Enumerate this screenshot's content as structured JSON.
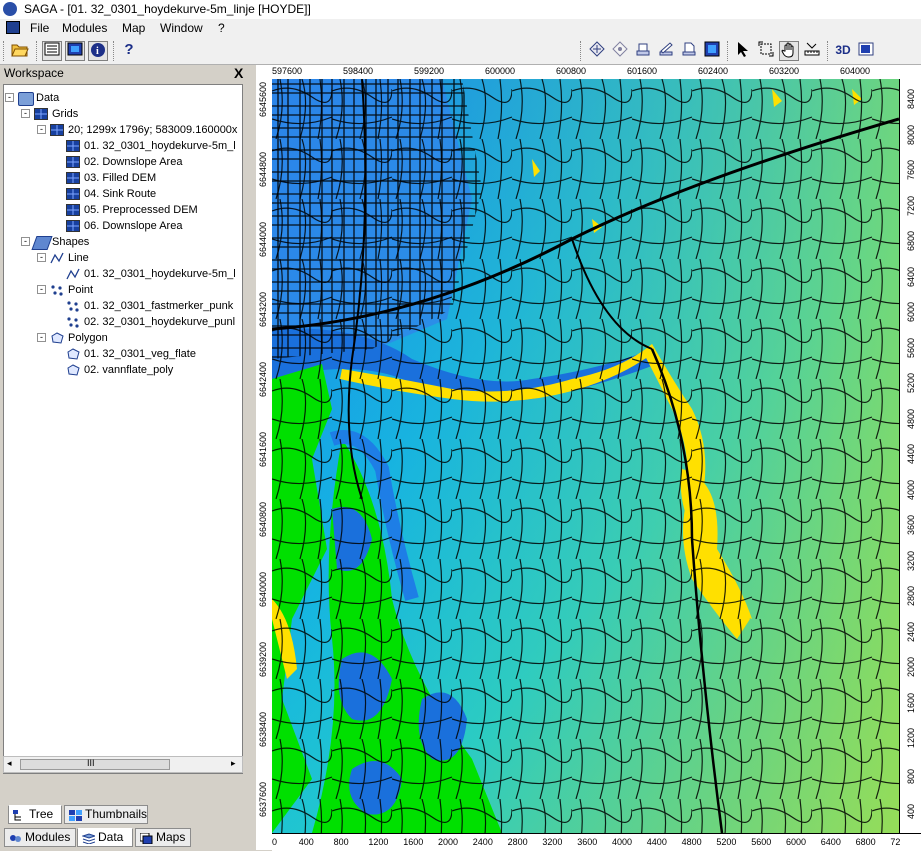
{
  "window": {
    "title": "SAGA - [01. 32_0301_hoydekurve-5m_linje [HOYDE]]"
  },
  "menu": {
    "items": [
      "File",
      "Modules",
      "Map",
      "Window",
      "?"
    ]
  },
  "toolbar": {
    "left_icons": [
      "open-icon",
      "workspace-icon",
      "object-properties-icon",
      "data-source-icon",
      "help-icon"
    ],
    "right_icons": [
      "zoom-full-icon",
      "zoom-layer-icon",
      "zoom-selection-icon",
      "zoom-active-icon",
      "synchronize-icon",
      "map-window-icon",
      "select-icon",
      "zoom-icon",
      "pan-icon",
      "measure-icon",
      "3d-view-icon",
      "layout-icon"
    ],
    "label_3d": "3D"
  },
  "workspace": {
    "title": "Workspace",
    "close_label": "X",
    "tree": [
      {
        "label": "Data",
        "level": 0,
        "icon": "data-icon",
        "expander": "-"
      },
      {
        "label": "Grids",
        "level": 1,
        "icon": "grids-icon",
        "expander": "-"
      },
      {
        "label": "20; 1299x 1796y; 583009.160000x",
        "level": 2,
        "icon": "grid-system-icon",
        "expander": "-"
      },
      {
        "label": "01. 32_0301_hoydekurve-5m_l",
        "level": 3,
        "icon": "grid-icon"
      },
      {
        "label": "02. Downslope Area",
        "level": 3,
        "icon": "grid-icon"
      },
      {
        "label": "03. Filled DEM",
        "level": 3,
        "icon": "grid-icon"
      },
      {
        "label": "04. Sink Route",
        "level": 3,
        "icon": "grid-icon"
      },
      {
        "label": "05. Preprocessed DEM",
        "level": 3,
        "icon": "grid-icon"
      },
      {
        "label": "06. Downslope Area",
        "level": 3,
        "icon": "grid-icon"
      },
      {
        "label": "Shapes",
        "level": 1,
        "icon": "shapes-icon",
        "expander": "-"
      },
      {
        "label": "Line",
        "level": 2,
        "icon": "line-icon",
        "expander": "-"
      },
      {
        "label": "01. 32_0301_hoydekurve-5m_l",
        "level": 3,
        "icon": "line-shape-icon"
      },
      {
        "label": "Point",
        "level": 2,
        "icon": "point-icon",
        "expander": "-"
      },
      {
        "label": "01. 32_0301_fastmerker_punk",
        "level": 3,
        "icon": "point-shape-icon"
      },
      {
        "label": "02. 32_0301_hoydekurve_punl",
        "level": 3,
        "icon": "point-shape-icon"
      },
      {
        "label": "Polygon",
        "level": 2,
        "icon": "polygon-icon",
        "expander": "-"
      },
      {
        "label": "01. 32_0301_veg_flate",
        "level": 3,
        "icon": "polygon-shape-icon"
      },
      {
        "label": "02. vannflate_poly",
        "level": 3,
        "icon": "polygon-shape-icon"
      }
    ],
    "scroll_grip": "III",
    "view_tabs": [
      {
        "label": "Tree",
        "active": true
      },
      {
        "label": "Thumbnails",
        "active": false
      }
    ],
    "bottom_tabs": [
      {
        "label": "Modules",
        "active": false
      },
      {
        "label": "Data",
        "active": true
      },
      {
        "label": "Maps",
        "active": false
      }
    ]
  },
  "map": {
    "ruler_top": [
      "597600",
      "598400",
      "599200",
      "600000",
      "600800",
      "601600",
      "602400",
      "603200",
      "604000"
    ],
    "ruler_left": [
      "6645600",
      "6644800",
      "6644000",
      "6643200",
      "6642400",
      "6641600",
      "6640800",
      "6640000",
      "6639200",
      "6638400",
      "6637600"
    ],
    "ruler_right": [
      "8400",
      "8000",
      "7600",
      "7200",
      "6800",
      "6400",
      "6000",
      "5600",
      "5200",
      "4800",
      "4400",
      "4000",
      "3600",
      "3200",
      "2800",
      "2400",
      "2000",
      "1600",
      "1200",
      "800",
      "400"
    ],
    "ruler_bottom": [
      "0",
      "400",
      "800",
      "1200",
      "1600",
      "2000",
      "2400",
      "2800",
      "3200",
      "3600",
      "4000",
      "4400",
      "4800",
      "5200",
      "5600",
      "6000",
      "6400",
      "6800",
      "72"
    ],
    "colors": {
      "water": "#1e7ee6",
      "lowland": "#16b4e4",
      "mid": "#2ed0c8",
      "high": "#7fdf5e",
      "green": "#00e000",
      "yellow": "#ffe000",
      "road": "#000000"
    }
  }
}
